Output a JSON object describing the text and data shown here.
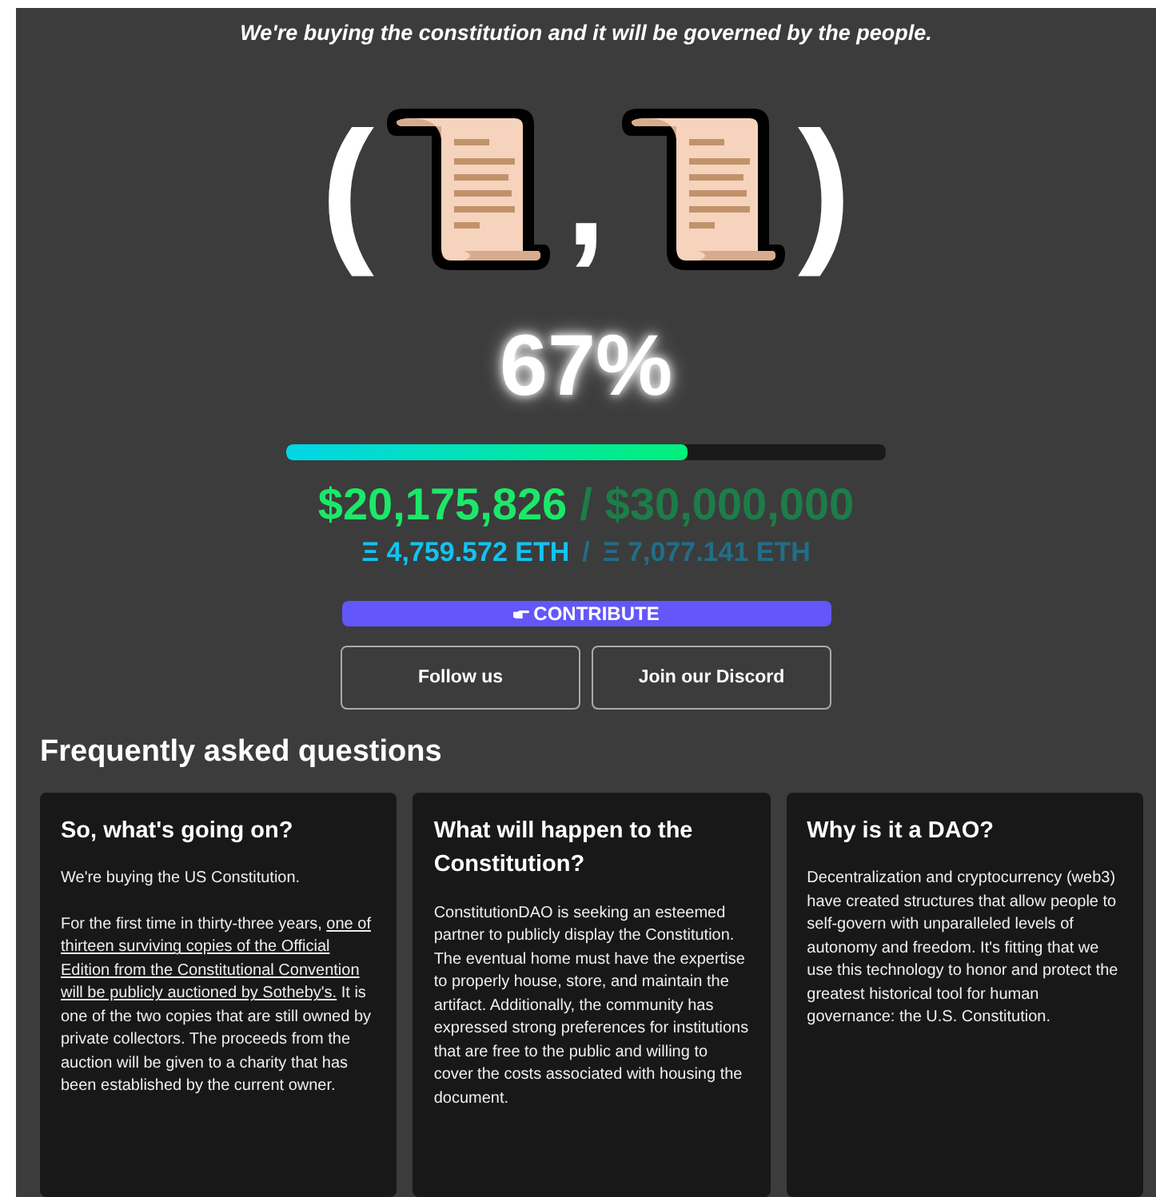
{
  "tagline": "We're buying the constitution and it will be governed by the people.",
  "hero": {
    "open": "(",
    "separator": ",",
    "close": ")"
  },
  "progress": {
    "percent": "67%",
    "level": 0.67
  },
  "usd": {
    "raised": "$20,175,826",
    "divider": "/",
    "goal": "$30,000,000"
  },
  "eth": {
    "raised": "Ξ 4,759.572 ETH",
    "divider": "/",
    "goal": "Ξ 7,077.141 ETH"
  },
  "contribute": "CONTRIBUTE",
  "buttons": [
    "Follow us",
    "Join our Discord"
  ],
  "faq": {
    "heading": "Frequently asked questions",
    "cards": [
      {
        "title": "So, what's going on?",
        "paragraphs": [
          {
            "text": "We're buying the US Constitution."
          },
          {
            "before": "For the first time in thirty-three years, ",
            "link": "one of thirteen surviving copies of the Official Edition from the Constitutional Convention will be publicly auctioned by Sotheby's.",
            "after": " It is one of the two copies that are still owned by private collectors. The proceeds from the auction will be given to a charity that has been established by the current owner."
          }
        ]
      },
      {
        "title": "What will happen to the Constitution?",
        "paragraphs": [
          {
            "text": "ConstitutionDAO is seeking an esteemed partner to publicly display the Constitution. The eventual home must have the expertise to properly house, store, and maintain the artifact. Additionally, the community has expressed strong preferences for institutions that are free to the public and willing to cover the costs associated with housing the document."
          }
        ]
      },
      {
        "title": "Why is it a DAO?",
        "paragraphs": [
          {
            "text": "Decentralization and cryptocurrency (web3) have created structures that allow people to self-govern with unparalleled levels of autonomy and freedom. It's fitting that we use this technology to honor and protect the greatest historical tool for human governance: the U.S. Constitution."
          }
        ]
      }
    ]
  }
}
